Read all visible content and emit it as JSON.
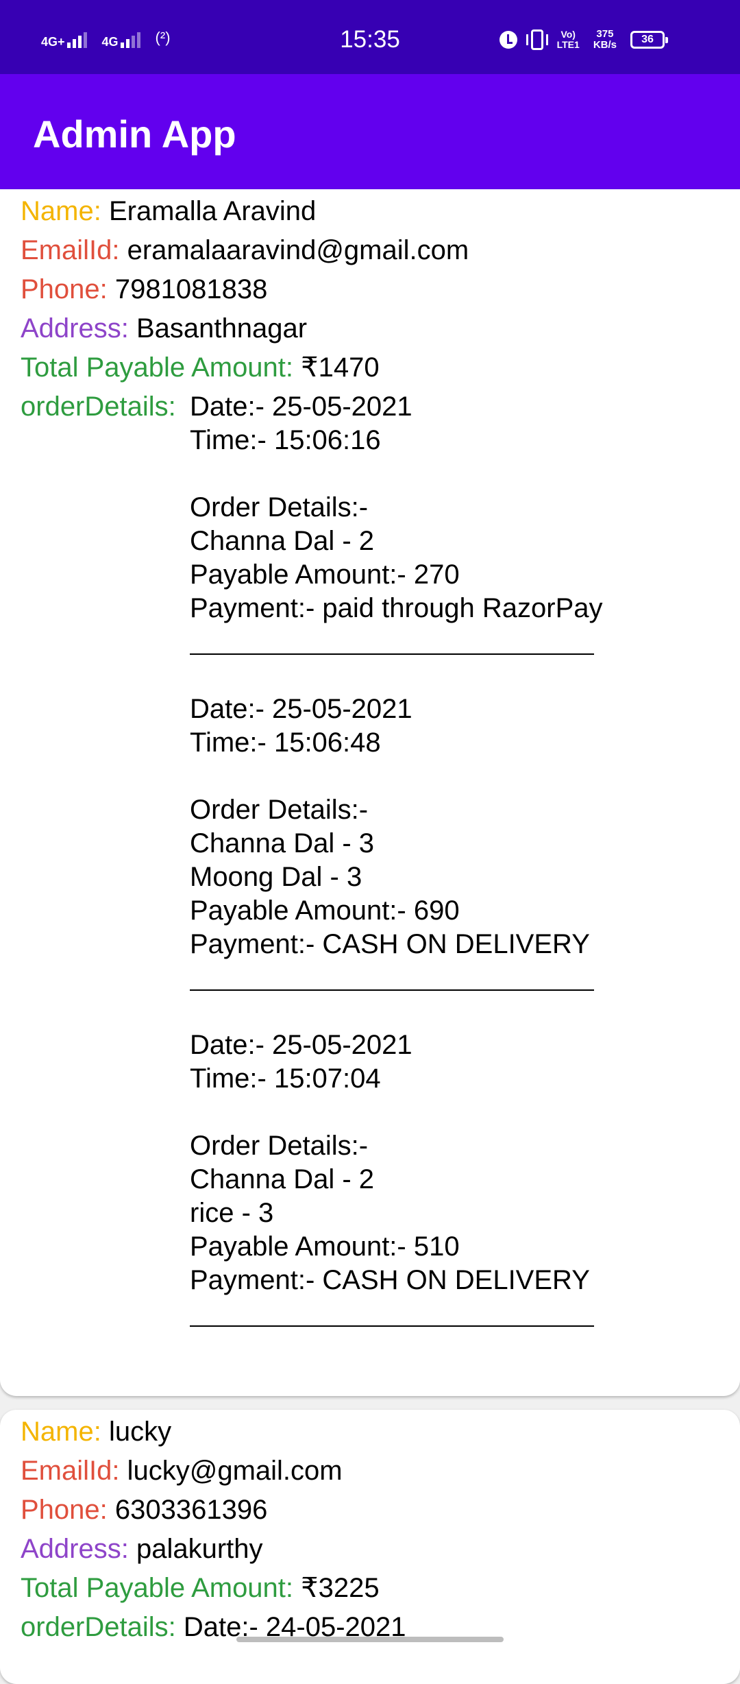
{
  "status_bar": {
    "signal1_label": "4G+",
    "signal2_label": "4G",
    "hotspot_label": "(²)",
    "time": "15:35",
    "volte_line1": "Vo)",
    "volte_line2": "LTE1",
    "speed_value": "375",
    "speed_unit": "KB/s",
    "battery": "36",
    "icons": [
      "signal-4g-plus-icon",
      "signal-4g-icon",
      "hotspot-icon",
      "alarm-icon",
      "vibrate-icon",
      "volte-icon",
      "battery-icon"
    ]
  },
  "app_bar": {
    "title": "Admin App"
  },
  "colors": {
    "status_bar": "#3700b3",
    "app_bar": "#6200ee",
    "name_label": "#f4b400",
    "email_label": "#e04f3c",
    "phone_label": "#e04f3c",
    "address_label": "#8e44c9",
    "total_label": "#2e9c3f",
    "order_label": "#2e9c3f"
  },
  "labels": {
    "name": "Name: ",
    "email": "EmailId: ",
    "phone": "Phone: ",
    "address": "Address: ",
    "total": "Total Payable Amount: ",
    "order_details": "orderDetails: "
  },
  "users": [
    {
      "name": "Eramalla Aravind",
      "email": "eramalaaravind@gmail.com",
      "phone": "7981081838",
      "address": "Basanthnagar",
      "total": "₹1470",
      "orders": [
        {
          "date": "Date:- 25-05-2021",
          "time": "Time:- 15:06:16",
          "header": "Order Details:-",
          "items": [
            "Channa Dal - 2"
          ],
          "payable": "Payable Amount:- 270",
          "payment": "Payment:- paid through RazorPay"
        },
        {
          "date": "Date:- 25-05-2021",
          "time": "Time:- 15:06:48",
          "header": "Order Details:-",
          "items": [
            "Channa Dal - 3",
            "Moong Dal - 3"
          ],
          "payable": "Payable Amount:- 690",
          "payment": "Payment:- CASH ON DELIVERY"
        },
        {
          "date": "Date:- 25-05-2021",
          "time": "Time:- 15:07:04",
          "header": "Order Details:-",
          "items": [
            "Channa Dal - 2",
            "rice - 3"
          ],
          "payable": "Payable Amount:- 510",
          "payment": "Payment:- CASH ON DELIVERY"
        }
      ]
    },
    {
      "name": "lucky",
      "email": "lucky@gmail.com",
      "phone": "6303361396",
      "address": "palakurthy",
      "total": "₹3225",
      "orders": [
        {
          "date": "Date:- 24-05-2021"
        }
      ]
    }
  ]
}
